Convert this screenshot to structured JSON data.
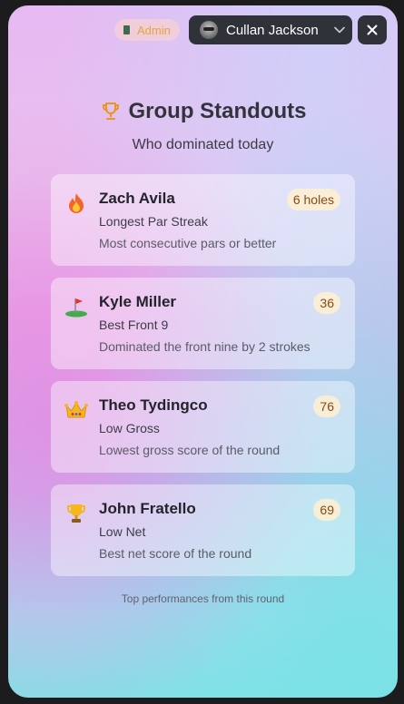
{
  "header": {
    "admin_label": "Admin",
    "user_name": "Cullan Jackson"
  },
  "page": {
    "title": "Group Standouts",
    "subtitle": "Who dominated today",
    "footer": "Top performances from this round"
  },
  "standouts": [
    {
      "icon": "fire-icon",
      "name": "Zach Avila",
      "award": "Longest Par Streak",
      "description": "Most consecutive pars or better",
      "value": "6 holes"
    },
    {
      "icon": "golf-flag-icon",
      "name": "Kyle Miller",
      "award": "Best Front 9",
      "description": "Dominated the front nine by 2 strokes",
      "value": "36"
    },
    {
      "icon": "crown-icon",
      "name": "Theo Tydingco",
      "award": "Low Gross",
      "description": "Lowest gross score of the round",
      "value": "76"
    },
    {
      "icon": "trophy-icon",
      "name": "John Fratello",
      "award": "Low Net",
      "description": "Best net score of the round",
      "value": "69"
    }
  ],
  "colors": {
    "accent_trophy": "#e8961e",
    "admin_text": "#e8a43c",
    "dark_control": "#30323a",
    "value_badge_bg": "#fff0d2",
    "value_badge_text": "#8a4a10"
  }
}
